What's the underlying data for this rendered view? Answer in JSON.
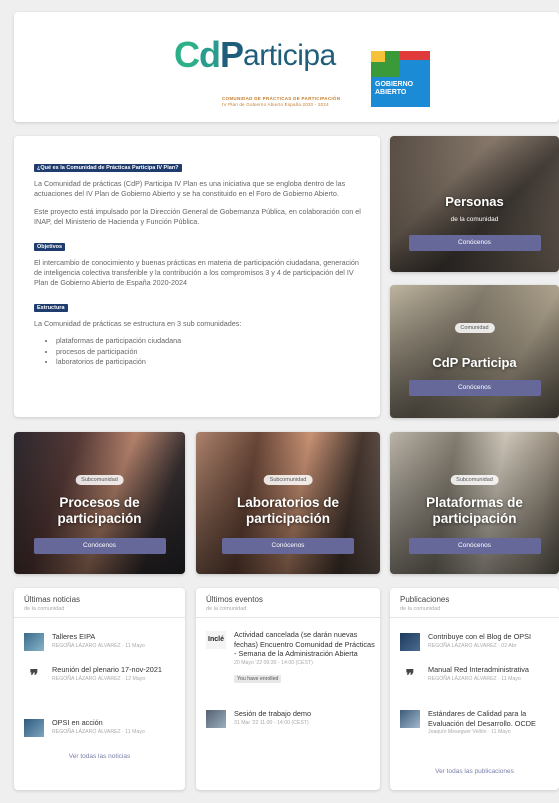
{
  "header": {
    "logo_text": "CdParticipa",
    "logo_subtitle_1": "COMUNIDAD DE PRÁCTICAS DE PARTICIPACIÓN",
    "logo_subtitle_2": "IV Plan de Gobierno Abierto España 2020 - 2024",
    "gob_text_1": "GOBIERNO",
    "gob_text_2": "ABIERTO",
    "colors": {
      "green": "#2db08a",
      "teal": "#2a9c8e",
      "navy": "#1e5e7a",
      "orange": "#c77c2b",
      "gob_blue": "#1b8bd6"
    }
  },
  "intro": {
    "tag_1": "¿Qué es la Comunidad de Prácticas Participa IV Plan?",
    "p1": "La Comunidad de prácticas (CdP) Participa IV Plan es una iniciativa que se engloba dentro de las actuaciones del IV Plan de Gobierno Abierto y se ha constituido en el Foro de Gobierno Abierto.",
    "p2": "Este proyecto está impulsado por la Dirección General de Gobernanza Pública, en colaboración con el INAP, del Ministerio de Hacienda y Función Pública.",
    "tag_2": "Objetivos",
    "p3": "El intercambio de conocimiento y buenas prácticas en materia de participación ciudadana, generación de inteligencia colectiva transferible y la contribución a los compromisos 3 y 4 de participación del IV Plan de Gobierno Abierto de España 2020-2024",
    "tag_3": "Estructura",
    "p4": "La Comunidad de prácticas se estructura en 3 sub comunidades:",
    "list": [
      "plataformas de participación ciudadana",
      "procesos de participación",
      "laboratorios de participación"
    ]
  },
  "cards": {
    "personas": {
      "title": "Personas",
      "subtitle": "de la comunidad",
      "button": "Conócenos"
    },
    "cdp": {
      "pill": "Comunidad",
      "title": "CdP Participa",
      "button": "Conócenos"
    },
    "procesos": {
      "pill": "Subcomunidad",
      "title_1": "Procesos de",
      "title_2": "participación",
      "button": "Conócenos"
    },
    "laboratorios": {
      "pill": "Subcomunidad",
      "title_1": "Laboratorios de",
      "title_2": "participación",
      "button": "Conócenos"
    },
    "plataformas": {
      "pill": "Subcomunidad",
      "title_1": "Plataformas de",
      "title_2": "participación",
      "button": "Conócenos"
    },
    "button_color": "#66689a"
  },
  "noticias": {
    "title": "Últimas noticias",
    "subtitle": "de la comunidad",
    "items": [
      {
        "title": "Talleres EIPA",
        "meta": "REGOÑA LÁZARO ÁLVAREZ · 11 Mayo"
      },
      {
        "title": "Reunión del plenario 17-nov-2021",
        "meta": "REGOÑA LÁZARO ÁLVAREZ · 12 Mayo"
      },
      {
        "title": "OPSI en acción",
        "meta": "REGOÑA LÁZARO ÁLVAREZ · 11 Mayo"
      }
    ],
    "more": "Ver todas las noticias"
  },
  "eventos": {
    "title": "Últimos eventos",
    "subtitle": "de la comunidad",
    "items": [
      {
        "title": "Actividad cancelada (se darán nuevas fechas) Encuentro Comunidad de Prácticas - Semana de la Administración Abierta",
        "meta": "20 Mayo '22 09:30 - 14:00 (CEST)",
        "badge": "You have enrolled"
      },
      {
        "title": "Sesión de trabajo demo",
        "meta": "31 Mar '22 11:00 - 14:00 (CEST)"
      }
    ]
  },
  "publicaciones": {
    "title": "Publicaciones",
    "subtitle": "de la comunidad",
    "items": [
      {
        "title": "Contribuye con el Blog de OPSI",
        "meta": "REGOÑA LÁZARO ÁLVAREZ · 02 Abr"
      },
      {
        "title": "Manual Red Interadministrativa",
        "meta": "REGOÑA LÁZARO ÁLVAREZ · 11 Mayo"
      },
      {
        "title": "Estándares de Calidad para la Evaluación del Desarrollo. OCDE",
        "meta": "Joaquín Meseguer Vellón · 11 Mayo"
      }
    ],
    "more": "Ver todas las publicaciones"
  }
}
